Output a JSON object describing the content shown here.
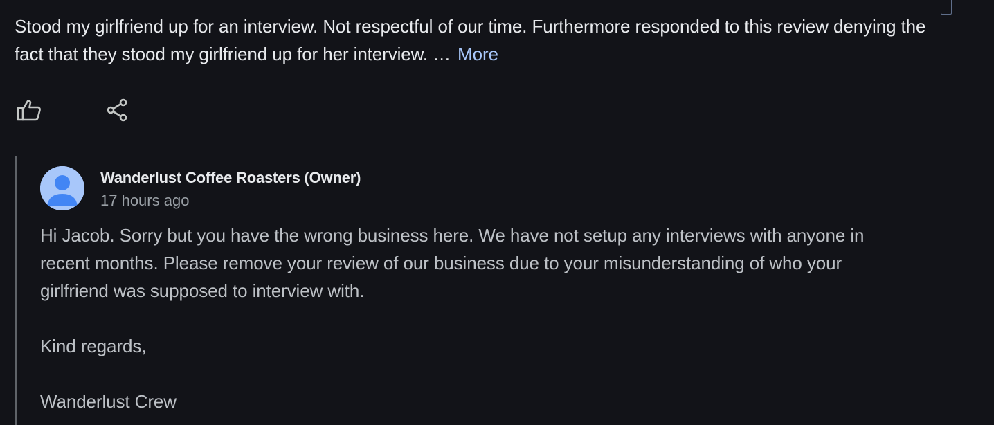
{
  "review": {
    "text": "Stood my girlfriend up for an interview. Not respectful of our time. Furthermore responded to this review denying the fact that they stood my girlfriend up for her interview. …",
    "more_label": "More"
  },
  "actions": {
    "like_icon": "thumbs-up-icon",
    "share_icon": "share-icon"
  },
  "owner_reply": {
    "name": "Wanderlust Coffee Roasters (Owner)",
    "time": "17 hours ago",
    "avatar_icon": "person-icon",
    "paragraphs": [
      "Hi Jacob. Sorry but you have the wrong business here. We have not setup any interviews with anyone in recent months. Please remove your review of our business due to your misunderstanding of who your girlfriend was supposed to interview with.",
      "Kind regards,",
      "Wanderlust Crew"
    ]
  },
  "colors": {
    "background": "#121318",
    "link": "#a8c7fa",
    "primary_text": "#e8eaed",
    "secondary_text": "#9aa0a6",
    "avatar": "#a8c7fa"
  }
}
